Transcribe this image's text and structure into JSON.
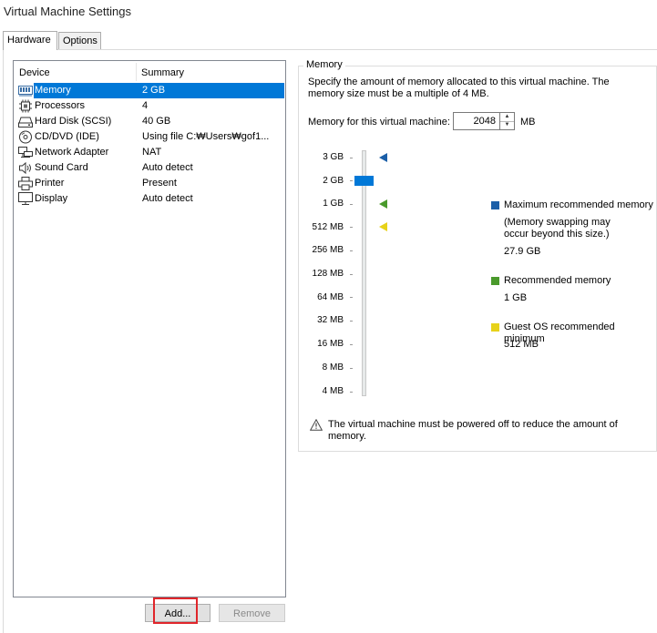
{
  "window": {
    "title": "Virtual Machine Settings"
  },
  "tabs": [
    {
      "label": "Hardware",
      "active": true
    },
    {
      "label": "Options",
      "active": false
    }
  ],
  "device_list": {
    "headers": {
      "device": "Device",
      "summary": "Summary"
    },
    "rows": [
      {
        "device": "Memory",
        "summary": "2 GB",
        "icon": "memory-icon",
        "selected": true
      },
      {
        "device": "Processors",
        "summary": "4",
        "icon": "processor-icon"
      },
      {
        "device": "Hard Disk (SCSI)",
        "summary": "40 GB",
        "icon": "hard-disk-icon"
      },
      {
        "device": "CD/DVD (IDE)",
        "summary": "Using file C:₩Users₩gof1...",
        "icon": "cd-dvd-icon"
      },
      {
        "device": "Network Adapter",
        "summary": "NAT",
        "icon": "network-adapter-icon"
      },
      {
        "device": "Sound Card",
        "summary": "Auto detect",
        "icon": "sound-card-icon"
      },
      {
        "device": "Printer",
        "summary": "Present",
        "icon": "printer-icon"
      },
      {
        "device": "Display",
        "summary": "Auto detect",
        "icon": "display-icon"
      }
    ]
  },
  "buttons": {
    "add": "Add...",
    "remove": "Remove"
  },
  "memory": {
    "group_title": "Memory",
    "description": "Specify the amount of memory allocated to this virtual machine. The memory size must be a multiple of 4 MB.",
    "field_label": "Memory for this virtual machine:",
    "value": "2048",
    "unit": "MB",
    "slider_labels": [
      "3 GB",
      "2 GB",
      "1 GB",
      "512 MB",
      "256 MB",
      "128 MB",
      "64 MB",
      "32 MB",
      "16 MB",
      "8 MB",
      "4 MB"
    ],
    "slider_value": "2 GB",
    "legend": {
      "max": {
        "title": "Maximum recommended memory",
        "note": "(Memory swapping may occur beyond this size.)",
        "value": "27.9 GB",
        "color": "#1c5fa8"
      },
      "recommended": {
        "title": "Recommended memory",
        "value": "1 GB",
        "color": "#4a9a2c"
      },
      "guest_min": {
        "title": "Guest OS recommended minimum",
        "value": "512 MB",
        "color": "#e7d21a"
      }
    },
    "warning": "The virtual machine must be powered off to reduce the amount of memory."
  }
}
